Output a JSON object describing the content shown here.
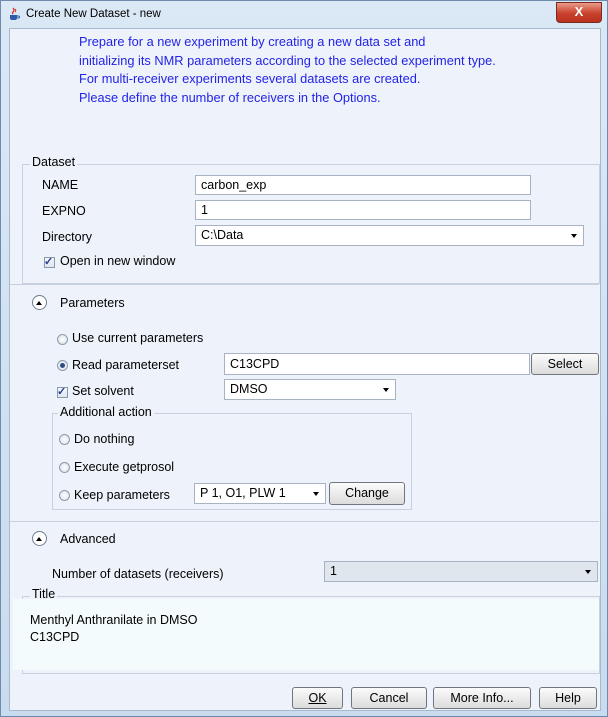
{
  "window": {
    "title": "Create New Dataset - new",
    "close_glyph": "X"
  },
  "intro_lines": [
    "Prepare for a new experiment by creating a new data set and",
    "initializing its NMR parameters according to the selected experiment type.",
    "For multi-receiver experiments several datasets are created.",
    "Please define the number of receivers in the Options."
  ],
  "dataset": {
    "group_label": "Dataset",
    "name_label": "NAME",
    "name_value": "carbon_exp",
    "expno_label": "EXPNO",
    "expno_value": "1",
    "directory_label": "Directory",
    "directory_value": "C:\\Data",
    "open_new_window_label": "Open in new window",
    "open_new_window_checked": true
  },
  "parameters": {
    "section_label": "Parameters",
    "use_current_label": "Use current parameters",
    "read_paramset_label": "Read parameterset",
    "read_paramset_value": "C13CPD",
    "select_button": "Select",
    "set_solvent_label": "Set solvent",
    "set_solvent_checked": true,
    "solvent_value": "DMSO",
    "selected_option": "read_parameterset"
  },
  "additional_action": {
    "group_label": "Additional action",
    "do_nothing_label": "Do nothing",
    "execute_label": "Execute getprosol",
    "keep_label": "Keep parameters",
    "keep_value": "P 1, O1, PLW 1",
    "change_button": "Change"
  },
  "advanced": {
    "section_label": "Advanced",
    "num_datasets_label": "Number of datasets (receivers)",
    "num_datasets_value": "1"
  },
  "title_section": {
    "group_label": "Title",
    "lines": [
      "Menthyl Anthranilate in DMSO",
      "C13CPD"
    ]
  },
  "buttons": {
    "ok": "OK",
    "cancel": "Cancel",
    "more_info": "More Info...",
    "help": "Help"
  },
  "icons": {
    "app": "java-coffee-icon",
    "close": "close-icon",
    "collapse": "collapse-up-icon",
    "dropdown": "chevron-down-icon",
    "checkbox": "checkbox-checked",
    "radio": "radio-button"
  }
}
